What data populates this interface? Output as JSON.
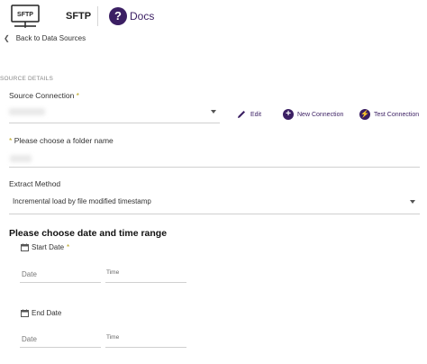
{
  "header": {
    "logo_text": "SFTP",
    "app_title": "SFTP",
    "docs_label": "Docs",
    "docs_icon": "question-circle-icon"
  },
  "nav": {
    "back_label": "Back to Data Sources"
  },
  "source_details": {
    "section_label": "SOURCE DETAILS",
    "connection_label": "Source Connection",
    "connection_value": "",
    "edit_label": "Edit",
    "new_connection_label": "New Connection",
    "test_connection_label": "Test Connection",
    "folder_label": "Please choose a folder name",
    "folder_value": "",
    "extract_label": "Extract Method",
    "extract_value": "Incremental load by file modified timestamp"
  },
  "date_range": {
    "heading": "Please choose date and time range",
    "start_label": "Start Date",
    "end_label": "End Date",
    "date_placeholder": "Date",
    "time_placeholder": "Time"
  },
  "colors": {
    "accent": "#3b1f63",
    "required": "#b9a21a"
  }
}
